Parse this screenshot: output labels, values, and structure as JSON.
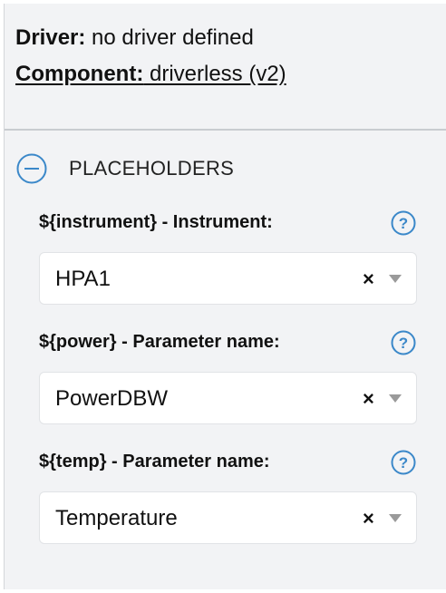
{
  "driver": {
    "label": "Driver:",
    "value": "no driver defined"
  },
  "component": {
    "label": "Component:",
    "value": "driverless (v2)"
  },
  "section": {
    "title": "PLACEHOLDERS",
    "icon": "collapse-minus-circle",
    "expanded": true
  },
  "fields": [
    {
      "label": "${instrument} - Instrument:",
      "value": "HPA1",
      "clear": "×"
    },
    {
      "label": "${power} - Parameter name:",
      "value": "PowerDBW",
      "clear": "×"
    },
    {
      "label": "${temp} - Parameter name:",
      "value": "Temperature",
      "clear": "×"
    }
  ],
  "colors": {
    "accent": "#3b88c9",
    "panel_bg": "#f2f3f5"
  }
}
